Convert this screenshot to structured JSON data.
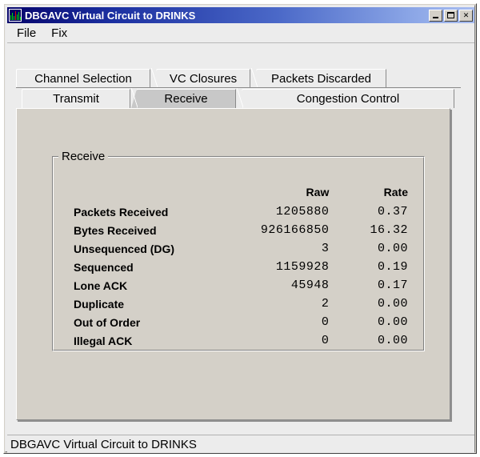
{
  "window": {
    "title": "DBGAVC Virtual Circuit to DRINKS",
    "icon": "bar-chart-icon",
    "controls": {
      "minimize_label": "_",
      "maximize_label": "□",
      "close_label": "✕"
    }
  },
  "menubar": {
    "items": [
      {
        "label": "File"
      },
      {
        "label": "Fix"
      }
    ]
  },
  "tabs": {
    "top_row": [
      {
        "label": "Channel Selection",
        "selected": false
      },
      {
        "label": "VC Closures",
        "selected": false
      },
      {
        "label": "Packets Discarded",
        "selected": false
      }
    ],
    "bottom_row": [
      {
        "label": "Transmit",
        "selected": false
      },
      {
        "label": "Receive",
        "selected": true
      },
      {
        "label": "Congestion Control",
        "selected": false
      }
    ]
  },
  "groupbox": {
    "title": "Receive",
    "columns": {
      "label_header": "",
      "raw_header": "Raw",
      "rate_header": "Rate"
    },
    "rows": [
      {
        "label": "Packets Received",
        "raw": "1205880",
        "rate": "0.37"
      },
      {
        "label": "Bytes Received",
        "raw": "926166850",
        "rate": "16.32"
      },
      {
        "label": "Unsequenced (DG)",
        "raw": "3",
        "rate": "0.00"
      },
      {
        "label": "Sequenced",
        "raw": "1159928",
        "rate": "0.19"
      },
      {
        "label": "Lone ACK",
        "raw": "45948",
        "rate": "0.17"
      },
      {
        "label": "Duplicate",
        "raw": "2",
        "rate": "0.00"
      },
      {
        "label": "Out of Order",
        "raw": "0",
        "rate": "0.00"
      },
      {
        "label": "Illegal ACK",
        "raw": "0",
        "rate": "0.00"
      }
    ]
  },
  "statusbar": {
    "text": "DBGAVC Virtual Circuit to DRINKS"
  },
  "colors": {
    "titlebar_start": "#06046b",
    "titlebar_end": "#a8bdf0",
    "face": "#d4d0c8",
    "panel": "#ececec",
    "selected_tab": "#c8c8c8",
    "icon_green": "#00e000",
    "icon_red": "#e00000"
  }
}
